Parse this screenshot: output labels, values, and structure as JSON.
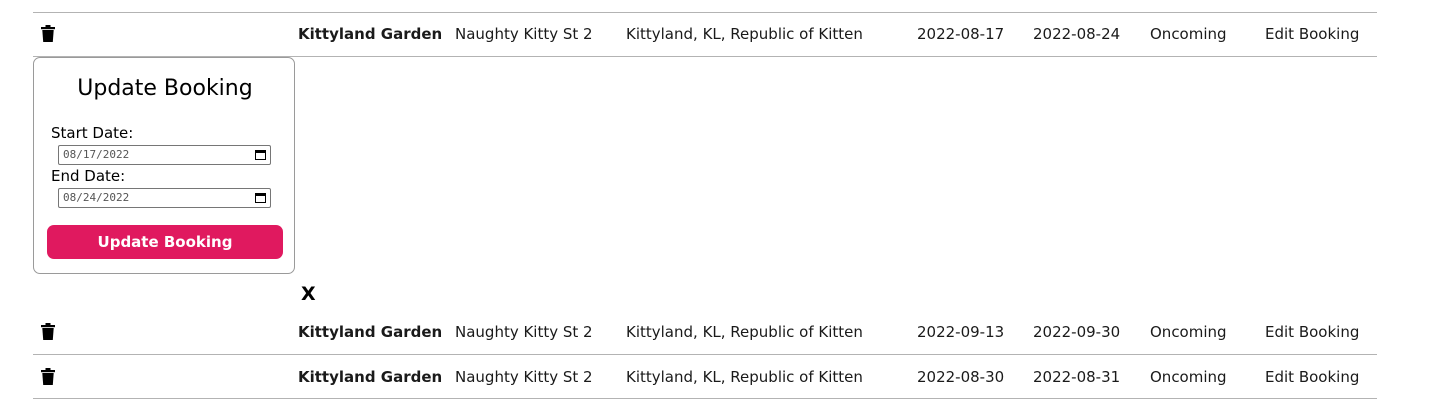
{
  "bookings": [
    {
      "name": "Kittyland Garden",
      "street": "Naughty Kitty St 2",
      "city": "Kittyland, KL, Republic of Kitten",
      "start": "2022-08-17",
      "end": "2022-08-24",
      "status": "Oncoming",
      "edit": "Edit Booking",
      "icon": "trash-icon"
    },
    {
      "name": "Kittyland Garden",
      "street": "Naughty Kitty St 2",
      "city": "Kittyland, KL, Republic of Kitten",
      "start": "2022-09-13",
      "end": "2022-09-30",
      "status": "Oncoming",
      "edit": "Edit Booking",
      "icon": "trash-icon"
    },
    {
      "name": "Kittyland Garden",
      "street": "Naughty Kitty St 2",
      "city": "Kittyland, KL, Republic of Kitten",
      "start": "2022-08-30",
      "end": "2022-08-31",
      "status": "Oncoming",
      "edit": "Edit Booking",
      "icon": "trash-icon"
    }
  ],
  "update_form": {
    "title": "Update Booking",
    "start_label": "Start Date:",
    "start_value": "08/17/2022",
    "end_label": "End Date:",
    "end_value": "08/24/2022",
    "submit_label": "Update Booking",
    "calendar_icon": "calendar-icon"
  },
  "close_label": "X",
  "colors": {
    "accent": "#e0195f",
    "divider": "#b3b3b3",
    "modal_border": "#9a9a9a"
  }
}
